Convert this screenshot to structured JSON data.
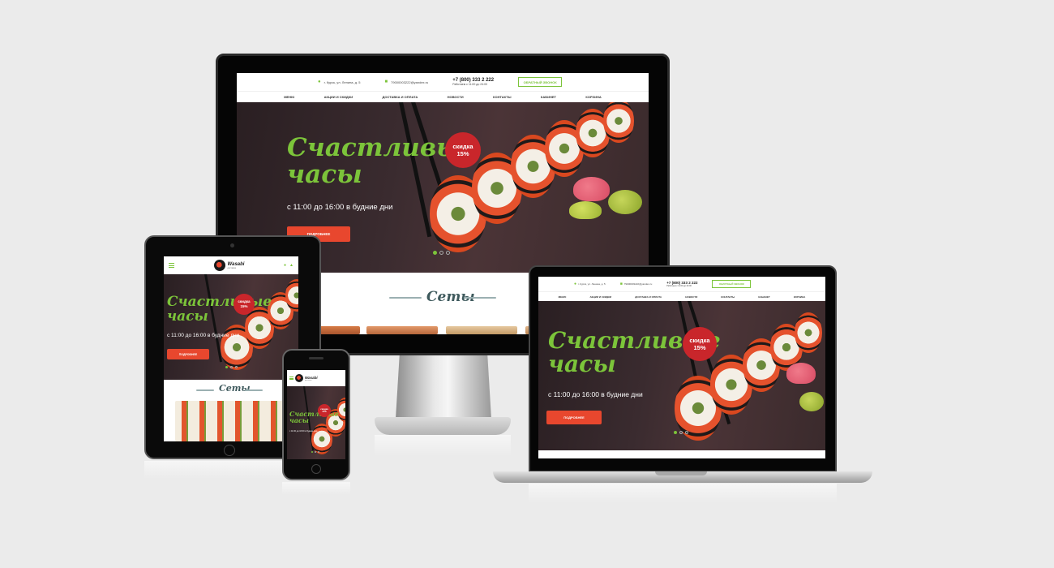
{
  "site": {
    "address": "г. Курск, ул. Ленина, д. 5",
    "email": "79000003222@yandex.ru",
    "phone": "+7 (800) 333 2 222",
    "hours": "Работаем с 11:00 до 24:00",
    "callback_label": "Обратный звонок",
    "logo_text": "Wasabi",
    "logo_sub": "доставка",
    "nav": [
      "Меню",
      "Акции и скидки",
      "Доставка и оплата",
      "Новости",
      "Контакты",
      "Кабинет",
      "Корзина"
    ]
  },
  "hero": {
    "title_line1": "Счастливые",
    "title_line2": "часы",
    "subtitle": "с 11:00 до 16:00 в будние дни",
    "button_label": "Подробнее",
    "badge_line1": "скидка",
    "badge_line2": "15%",
    "slides": 3,
    "active_slide": 1
  },
  "sections": {
    "sets_title": "Сеты"
  },
  "colors": {
    "accent_green": "#7cc43a",
    "button_red": "#e8472e",
    "badge_red": "#c9262b",
    "page_bg": "#ebebeb"
  },
  "icons": {
    "location": "location-pin-icon",
    "email": "envelope-icon",
    "menu": "hamburger-menu-icon",
    "user": "user-icon",
    "cart": "cart-icon"
  }
}
